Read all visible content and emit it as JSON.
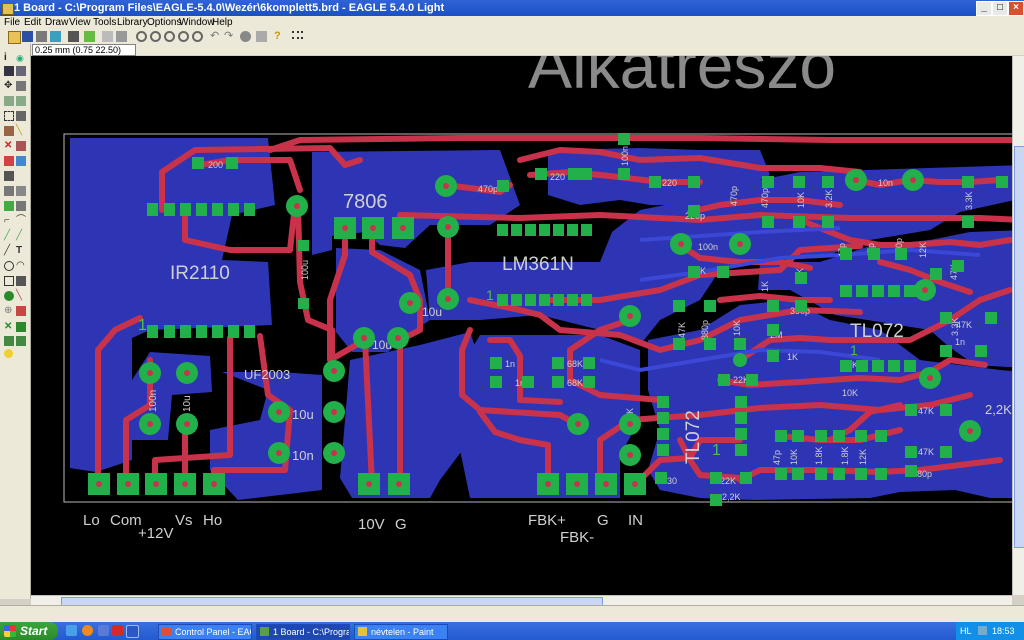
{
  "window": {
    "title": "1 Board - C:\\Program Files\\EAGLE-5.4.0\\Wezér\\6komplett5.brd - EAGLE 5.4.0 Light",
    "minimize": "_",
    "maximize": "□",
    "close": "×"
  },
  "menu": [
    "File",
    "Edit",
    "Draw",
    "View",
    "Tools",
    "Library",
    "Options",
    "Window",
    "Help"
  ],
  "coordinates": "0.25 mm (0.75 22.50)",
  "board": {
    "bg_text": "Alkatrészó",
    "parts": [
      {
        "name": "IR2110"
      },
      {
        "name": "7806"
      },
      {
        "name": "LM361N"
      },
      {
        "name": "UF2003"
      },
      {
        "name": "TL072",
        "id": "tl072a"
      },
      {
        "name": "TL072",
        "id": "tl072b"
      }
    ],
    "pin1": [
      "1",
      "1",
      "1",
      "1",
      "1"
    ],
    "values": [
      "100n",
      "10u",
      "10u",
      "10u",
      "10n",
      "100n",
      "10u",
      "100n",
      "470p",
      "220",
      "220",
      "200",
      "10n",
      "10n",
      "220p",
      "470p",
      "100n",
      "10K",
      "10K",
      "3.2K",
      "3.3K",
      "12K",
      "390p",
      "47p",
      "47p",
      "1.8K",
      "12K",
      "47K",
      "1K",
      "1K",
      "2M",
      "390p",
      "880p",
      "10K",
      "10K",
      "1K",
      "3.3K",
      "1.8K",
      "22K",
      "22K",
      "47K",
      "47K",
      "47K",
      "47K",
      "47p",
      "10K",
      "880p",
      "470p",
      "1n",
      "1n",
      "68K",
      "68K",
      "10K",
      "47K",
      "330",
      "680p",
      "2,2K",
      "1n",
      "10u",
      "100u"
    ],
    "connector_labels": [
      "Lo",
      "Com",
      "Vs",
      "Ho",
      "+12V",
      "10V",
      "G",
      "FBK+",
      "G",
      "IN",
      "FBK-"
    ]
  },
  "taskbar": {
    "start": "Start",
    "items": [
      {
        "label": "Control Panel - EAGL..."
      },
      {
        "label": "1 Board - C:\\Program..."
      },
      {
        "label": "névtelen - Paint"
      }
    ],
    "lang": "HL",
    "clock": "18:53"
  },
  "colors": {
    "top_copper": "#c8324b",
    "bottom_copper": "#2d35b4",
    "pad": "#22b04a",
    "canvas": "#000000",
    "outline": "#bfbfbf"
  }
}
